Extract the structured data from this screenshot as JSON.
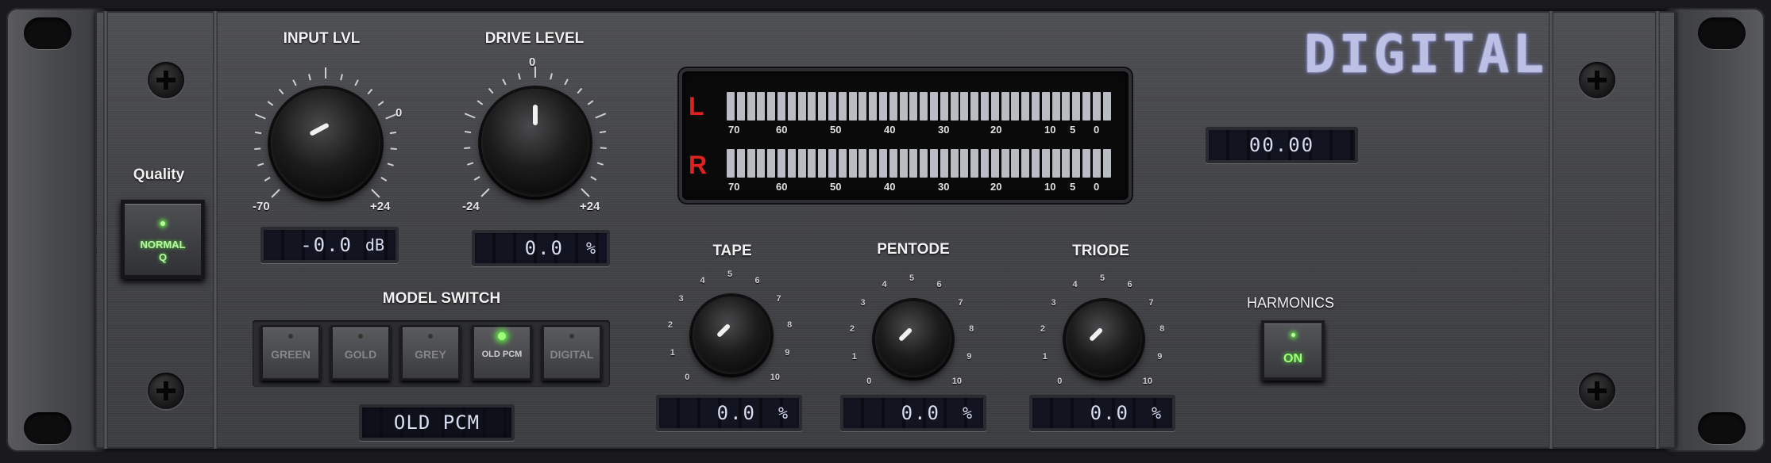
{
  "logo": {
    "text": "DIGITAL"
  },
  "quality": {
    "label": "Quality",
    "button_line1": "NORMAL",
    "button_line2": "Q"
  },
  "input_lvl": {
    "label": "INPUT LVL",
    "min": "-70",
    "max": "+24",
    "marker": "0",
    "value": "-0.0",
    "unit": "dB"
  },
  "drive_level": {
    "label": "DRIVE LEVEL",
    "min": "-24",
    "max": "+24",
    "marker": "0",
    "value": "0.0",
    "unit": "%"
  },
  "meter": {
    "left_label": "L",
    "right_label": "R",
    "scale": [
      "70",
      "60",
      "50",
      "40",
      "30",
      "20",
      "10",
      "5",
      "0"
    ]
  },
  "readout": {
    "value": "00.00"
  },
  "model_switch": {
    "label": "MODEL SWITCH",
    "buttons": [
      "GREEN",
      "GOLD",
      "GREY",
      "OLD PCM",
      "DIGITAL"
    ],
    "active": "OLD PCM",
    "display": "OLD PCM"
  },
  "tape": {
    "label": "TAPE",
    "value": "0.0",
    "unit": "%",
    "scale": [
      "0",
      "1",
      "2",
      "3",
      "4",
      "5",
      "6",
      "7",
      "8",
      "9",
      "10"
    ]
  },
  "pentode": {
    "label": "PENTODE",
    "value": "0.0",
    "unit": "%",
    "scale": [
      "0",
      "1",
      "2",
      "3",
      "4",
      "5",
      "6",
      "7",
      "8",
      "9",
      "10"
    ]
  },
  "triode": {
    "label": "TRIODE",
    "value": "0.0",
    "unit": "%",
    "scale": [
      "0",
      "1",
      "2",
      "3",
      "4",
      "5",
      "6",
      "7",
      "8",
      "9",
      "10"
    ]
  },
  "harmonics": {
    "label": "HARMONICS",
    "button": "ON"
  },
  "colors": {
    "led_green": "#66ff44",
    "meter_red": "#e12020",
    "lcd_text": "#d8ddf0",
    "logo": "#c9cdf5"
  }
}
